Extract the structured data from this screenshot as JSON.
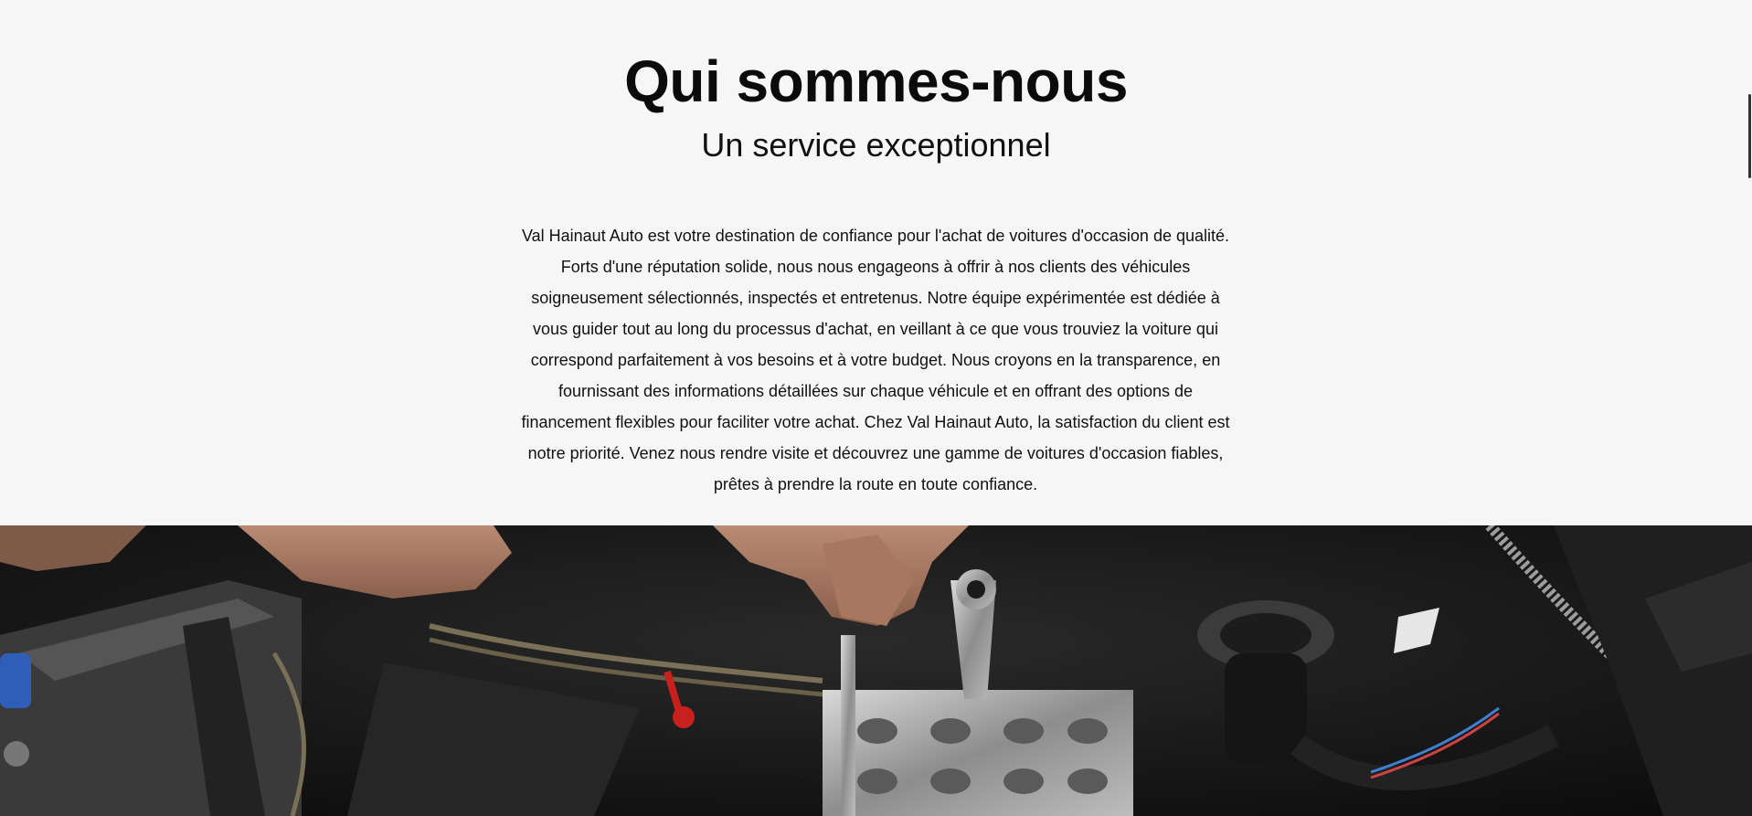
{
  "about": {
    "title": "Qui sommes-nous",
    "subtitle": "Un service exceptionnel",
    "body": "Val Hainaut Auto est votre destination de confiance pour l'achat de voitures d'occasion de qualité. Forts d'une réputation solide, nous nous engageons à offrir à nos clients des véhicules soigneusement sélectionnés, inspectés et entretenus. Notre équipe expérimentée est dédiée à vous guider tout au long du processus d'achat, en veillant à ce que vous trouviez la voiture qui correspond parfaitement à vos besoins et à votre budget. Nous croyons en la transparence, en fournissant des informations détaillées sur chaque véhicule et en offrant des options de financement flexibles pour faciliter votre achat. Chez Val Hainaut Auto, la satisfaction du client est notre priorité. Venez nous rendre visite et découvrez une gamme de voitures d'occasion fiables, prêtes à prendre la route en toute confiance."
  },
  "hero_image": {
    "icon": "engine-repair-photo"
  },
  "colors": {
    "background": "#f6f6f6",
    "text": "#111111"
  }
}
